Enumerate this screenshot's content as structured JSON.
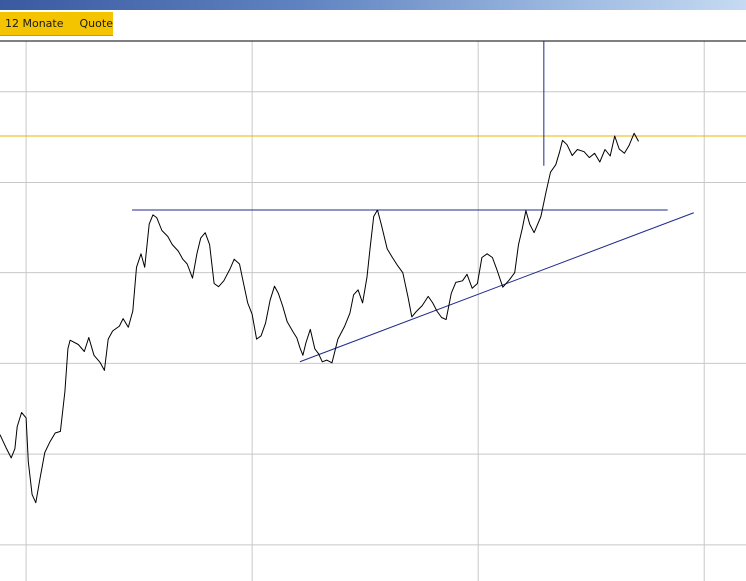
{
  "tabs": [
    {
      "label": "12 Monate"
    },
    {
      "label": "Quote"
    }
  ],
  "colors": {
    "tab_background": "#f5c400",
    "price_line": "#000000",
    "trend_lines": "#1f2a8c",
    "reference_line": "#e8b400",
    "grid": "#c8c8c8"
  },
  "chart_data": {
    "type": "line",
    "title": "",
    "xlabel": "",
    "ylabel": "",
    "grid": true,
    "xlim": [
      0,
      100
    ],
    "ylim": [
      0,
      100
    ],
    "x_grid": [
      3.5,
      33.8,
      64.1,
      94.4
    ],
    "y_grid": [
      6.7,
      23.5,
      40.3,
      57.1,
      73.8,
      90.6
    ],
    "series": [
      {
        "values": [
          [
            0,
            27.1
          ],
          [
            0.8,
            24.7
          ],
          [
            1.5,
            22.8
          ],
          [
            2.0,
            24.5
          ],
          [
            2.3,
            28.6
          ],
          [
            2.9,
            31.2
          ],
          [
            3.5,
            30.2
          ],
          [
            3.8,
            22.1
          ],
          [
            4.3,
            16.0
          ],
          [
            4.8,
            14.5
          ],
          [
            5.4,
            19.3
          ],
          [
            6.0,
            23.8
          ],
          [
            6.7,
            25.8
          ],
          [
            7.4,
            27.4
          ],
          [
            8.1,
            27.7
          ],
          [
            8.7,
            35.1
          ],
          [
            9.1,
            43.0
          ],
          [
            9.4,
            44.6
          ],
          [
            10.5,
            43.8
          ],
          [
            11.3,
            42.5
          ],
          [
            11.9,
            45.1
          ],
          [
            12.6,
            41.8
          ],
          [
            13.4,
            40.5
          ],
          [
            14.0,
            39.0
          ],
          [
            14.5,
            44.8
          ],
          [
            15.1,
            46.3
          ],
          [
            16.0,
            47.2
          ],
          [
            16.5,
            48.6
          ],
          [
            17.2,
            47.0
          ],
          [
            17.8,
            50.0
          ],
          [
            18.3,
            58.1
          ],
          [
            18.9,
            60.6
          ],
          [
            19.4,
            58.1
          ],
          [
            20.0,
            66.1
          ],
          [
            20.5,
            67.8
          ],
          [
            21.0,
            67.3
          ],
          [
            21.7,
            64.9
          ],
          [
            22.5,
            63.8
          ],
          [
            23.1,
            62.3
          ],
          [
            23.9,
            61.1
          ],
          [
            24.5,
            59.6
          ],
          [
            25.1,
            58.7
          ],
          [
            25.8,
            56.1
          ],
          [
            26.4,
            60.6
          ],
          [
            26.9,
            63.5
          ],
          [
            27.5,
            64.5
          ],
          [
            28.1,
            62.3
          ],
          [
            28.7,
            55.1
          ],
          [
            29.3,
            54.5
          ],
          [
            30.0,
            55.6
          ],
          [
            30.8,
            57.7
          ],
          [
            31.4,
            59.6
          ],
          [
            32.1,
            58.7
          ],
          [
            32.6,
            55.4
          ],
          [
            33.2,
            51.5
          ],
          [
            33.8,
            49.4
          ],
          [
            34.4,
            44.8
          ],
          [
            35.0,
            45.4
          ],
          [
            35.6,
            47.8
          ],
          [
            36.2,
            52.0
          ],
          [
            36.8,
            54.6
          ],
          [
            37.3,
            53.3
          ],
          [
            37.9,
            50.9
          ],
          [
            38.5,
            48.0
          ],
          [
            39.3,
            46.1
          ],
          [
            39.8,
            45.0
          ],
          [
            40.2,
            43.2
          ],
          [
            40.6,
            41.8
          ],
          [
            41.0,
            44.1
          ],
          [
            41.6,
            46.6
          ],
          [
            42.2,
            43.0
          ],
          [
            42.7,
            42.1
          ],
          [
            43.2,
            40.6
          ],
          [
            43.8,
            40.9
          ],
          [
            44.5,
            40.4
          ],
          [
            45.3,
            44.8
          ],
          [
            46.2,
            47.2
          ],
          [
            46.9,
            49.6
          ],
          [
            47.4,
            53.0
          ],
          [
            48.0,
            53.9
          ],
          [
            48.6,
            51.5
          ],
          [
            49.2,
            56.3
          ],
          [
            49.6,
            61.5
          ],
          [
            50.1,
            67.5
          ],
          [
            50.6,
            68.7
          ],
          [
            51.1,
            66.1
          ],
          [
            51.9,
            61.5
          ],
          [
            52.6,
            59.9
          ],
          [
            53.3,
            58.4
          ],
          [
            54.0,
            57.1
          ],
          [
            54.7,
            52.5
          ],
          [
            55.2,
            48.9
          ],
          [
            55.8,
            49.9
          ],
          [
            56.6,
            51.0
          ],
          [
            57.4,
            52.7
          ],
          [
            58.0,
            51.5
          ],
          [
            58.6,
            49.9
          ],
          [
            59.2,
            48.8
          ],
          [
            59.8,
            48.4
          ],
          [
            60.5,
            53.3
          ],
          [
            61.1,
            55.3
          ],
          [
            62.0,
            55.6
          ],
          [
            62.6,
            56.8
          ],
          [
            63.3,
            54.2
          ],
          [
            64.0,
            55.1
          ],
          [
            64.6,
            59.9
          ],
          [
            65.3,
            60.6
          ],
          [
            66.0,
            59.9
          ],
          [
            66.6,
            57.7
          ],
          [
            67.4,
            54.4
          ],
          [
            68.3,
            55.8
          ],
          [
            69.0,
            57.1
          ],
          [
            69.5,
            62.3
          ],
          [
            70.0,
            65.2
          ],
          [
            70.5,
            68.6
          ],
          [
            71.0,
            66.1
          ],
          [
            71.6,
            64.5
          ],
          [
            72.5,
            67.5
          ],
          [
            73.2,
            72.1
          ],
          [
            73.8,
            75.7
          ],
          [
            74.5,
            77.1
          ],
          [
            75.0,
            79.4
          ],
          [
            75.4,
            81.6
          ],
          [
            76.0,
            80.8
          ],
          [
            76.7,
            78.8
          ],
          [
            77.4,
            79.9
          ],
          [
            78.3,
            79.5
          ],
          [
            79.0,
            78.4
          ],
          [
            79.7,
            79.2
          ],
          [
            80.4,
            77.6
          ],
          [
            81.1,
            79.9
          ],
          [
            81.8,
            78.7
          ],
          [
            82.4,
            82.4
          ],
          [
            83.0,
            80.0
          ],
          [
            83.7,
            79.2
          ],
          [
            84.3,
            80.6
          ],
          [
            85.0,
            82.9
          ],
          [
            85.6,
            81.4
          ]
        ]
      }
    ],
    "resistance_line": [
      [
        17.7,
        68.7
      ],
      [
        89.5,
        68.7
      ]
    ],
    "support_trendline": [
      [
        40.2,
        40.6
      ],
      [
        93.0,
        68.2
      ]
    ],
    "spike_line": [
      [
        72.9,
        76.9
      ],
      [
        72.9,
        100
      ]
    ],
    "reference_line_y": 82.4,
    "top_border_y": 100
  }
}
